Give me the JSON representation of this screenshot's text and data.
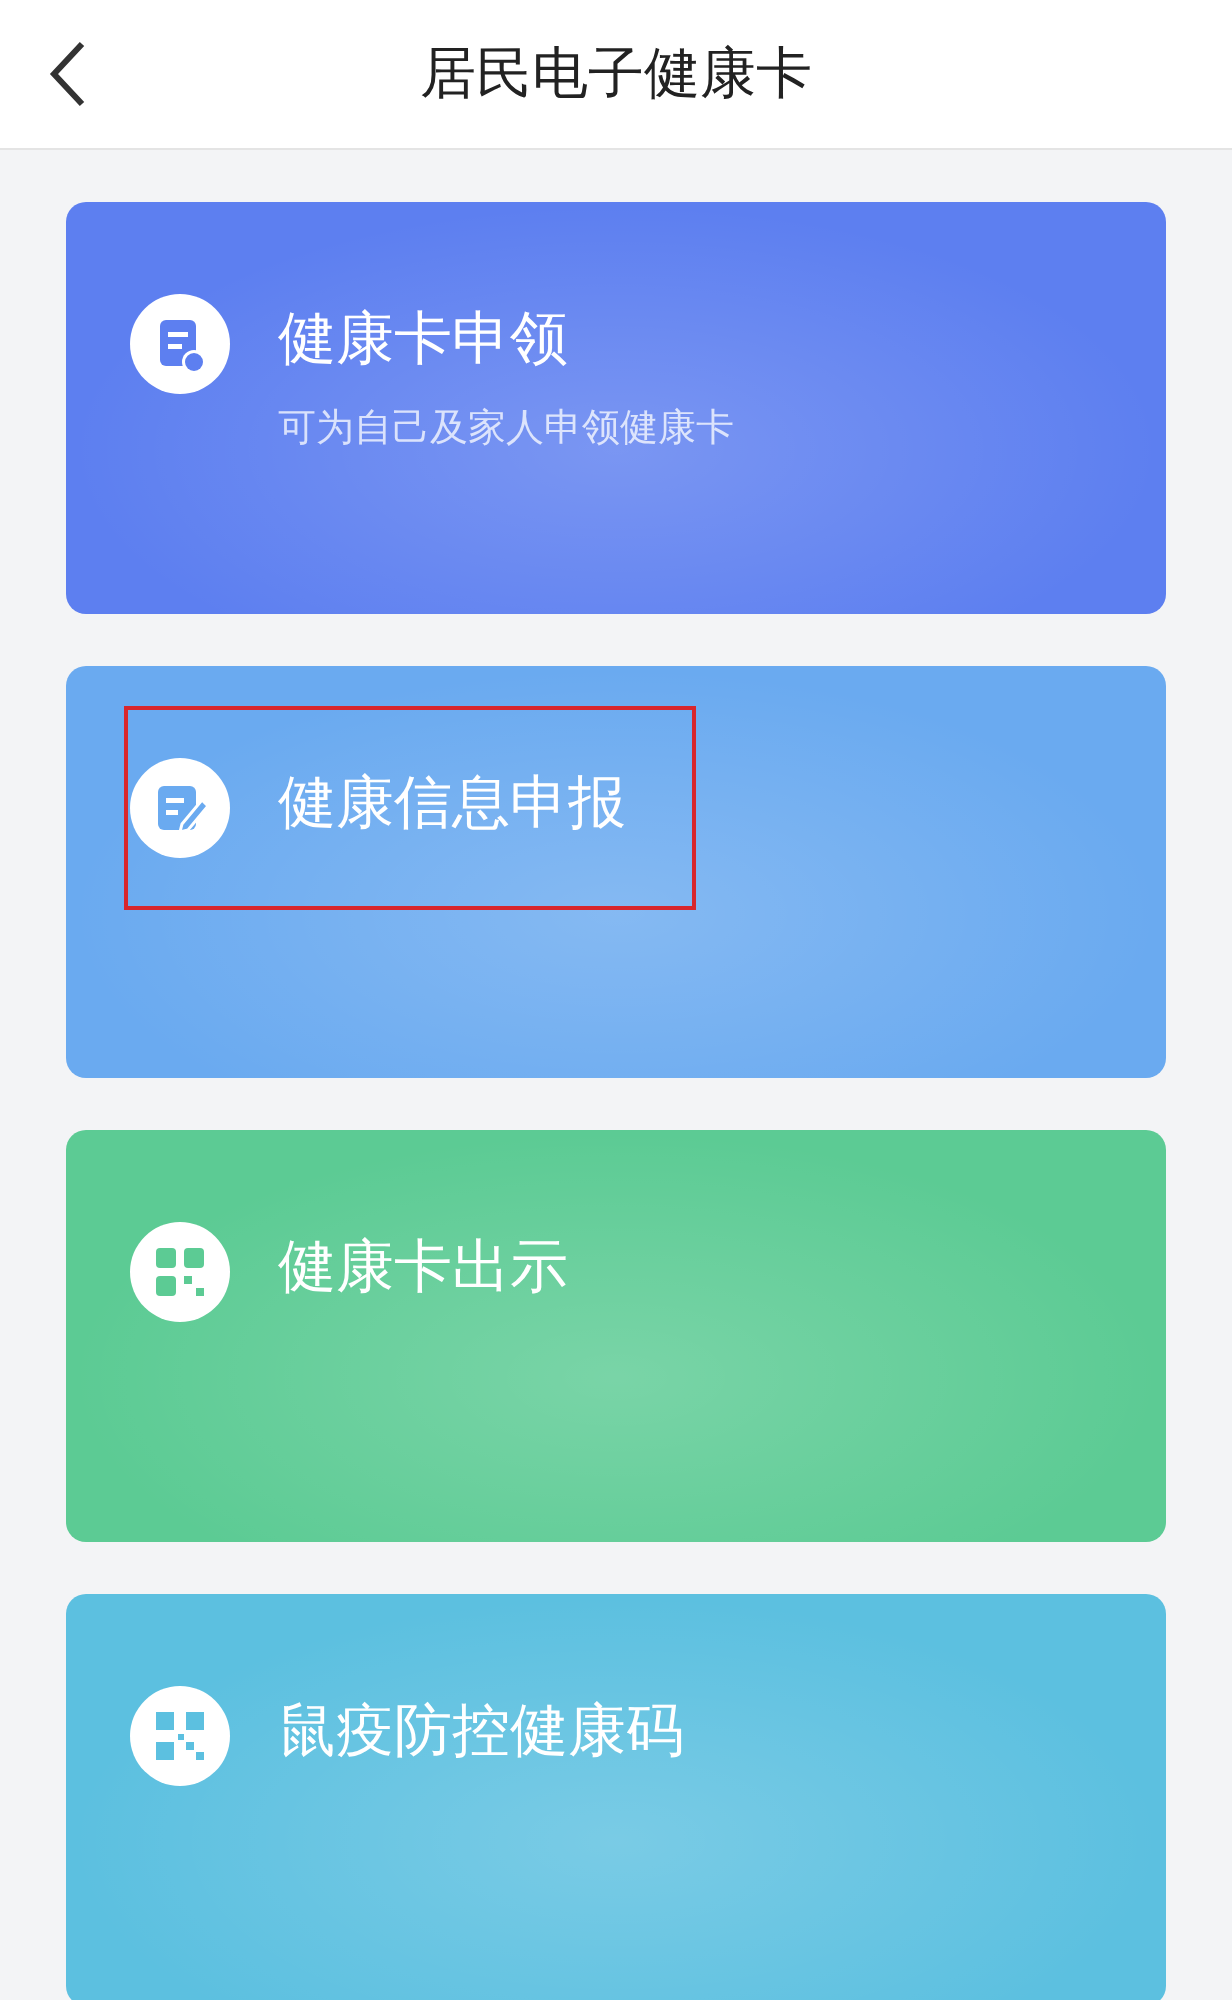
{
  "header": {
    "title": "居民电子健康卡"
  },
  "cards": [
    {
      "kind": "document",
      "title": "健康卡申领",
      "subtitle": "可为自己及家人申领健康卡",
      "color": "#5d7ff0",
      "highlighted": false
    },
    {
      "kind": "edit",
      "title": "健康信息申报",
      "color": "#6aaaf0",
      "highlighted": true
    },
    {
      "kind": "grid",
      "title": "健康卡出示",
      "color": "#5ccb94",
      "highlighted": false
    },
    {
      "kind": "qr",
      "title": "鼠疫防控健康码",
      "color": "#5cc0e0",
      "highlighted": false
    }
  ]
}
